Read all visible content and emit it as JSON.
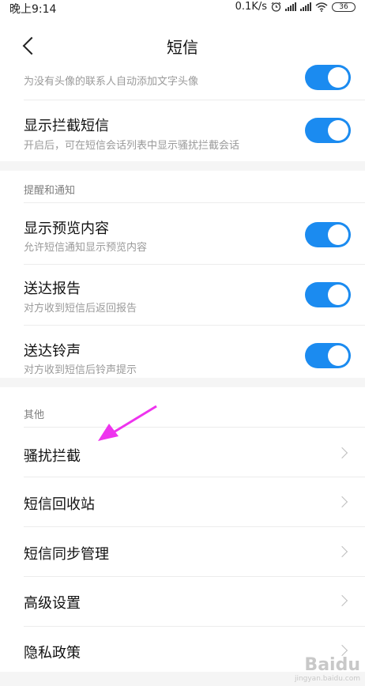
{
  "status_bar": {
    "time": "晚上9:14",
    "speed": "0.1K/s",
    "alarm_icon": "alarm-icon",
    "battery": "36"
  },
  "header": {
    "title": "短信",
    "back_icon": "chevron-left-icon"
  },
  "top_section": {
    "partial_item": {
      "subtitle": "为没有头像的联系人自动添加文字头像",
      "enabled": true
    },
    "items": [
      {
        "title": "显示拦截短信",
        "subtitle": "开启后，可在短信会话列表中显示骚扰拦截会话",
        "enabled": true
      }
    ]
  },
  "notify_section": {
    "label": "提醒和通知",
    "items": [
      {
        "title": "显示预览内容",
        "subtitle": "允许短信通知显示预览内容",
        "enabled": true
      },
      {
        "title": "送达报告",
        "subtitle": "对方收到短信后返回报告",
        "enabled": true
      },
      {
        "title": "送达铃声",
        "subtitle": "对方收到短信后铃声提示",
        "enabled": true
      }
    ]
  },
  "other_section": {
    "label": "其他",
    "items": [
      {
        "title": "骚扰拦截"
      },
      {
        "title": "短信回收站"
      },
      {
        "title": "短信同步管理"
      },
      {
        "title": "高级设置"
      },
      {
        "title": "隐私政策"
      }
    ]
  },
  "annotation": {
    "color": "#ee33ee"
  },
  "watermark": {
    "logo": "Baidu",
    "url": "jingyan.baidu.com"
  },
  "colors": {
    "accent": "#1b8bf0",
    "background": "#f5f5f5"
  }
}
